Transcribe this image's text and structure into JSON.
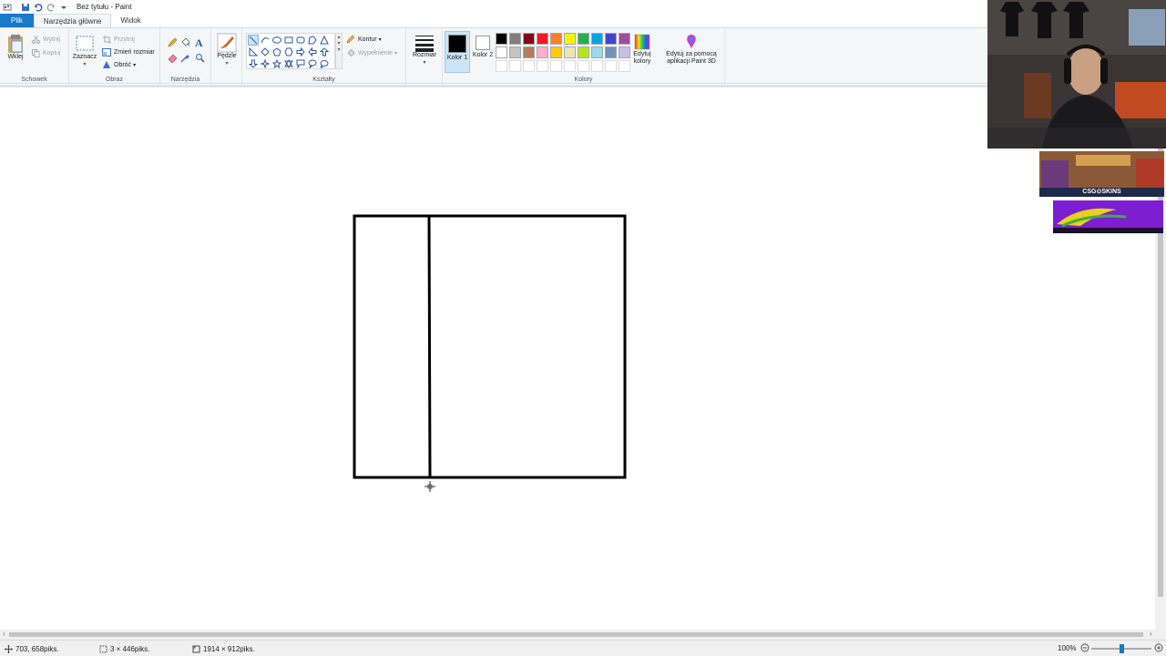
{
  "window": {
    "title": "Bez tytułu - Paint"
  },
  "tabs": [
    {
      "label": "Plik"
    },
    {
      "label": "Narzędzia główne"
    },
    {
      "label": "Widok"
    }
  ],
  "ribbon": {
    "clipboard": {
      "paste_label": "Wklej",
      "cut_label": "Wytnij",
      "copy_label": "Kopiuj",
      "group_label": "Schowek"
    },
    "image": {
      "select_label": "Zaznacz",
      "crop_label": "Przytnij",
      "resize_label": "Zmień rozmiar",
      "rotate_label": "Obróć",
      "group_label": "Obraz"
    },
    "tools": {
      "group_label": "Narzędzia"
    },
    "brushes": {
      "label": "Pędzle"
    },
    "shapes": {
      "outline_label": "Kontur",
      "fill_label": "Wypełnienie",
      "group_label": "Kształty"
    },
    "size": {
      "label": "Rozmiar"
    },
    "colors": {
      "color1_label": "Kolor 1",
      "color2_label": "Kolor 2",
      "edit_colors_label": "Edytuj kolory",
      "paint3d_label": "Edytuj za pomocą aplikacji Paint 3D",
      "group_label": "Kolory",
      "color1": "#000000",
      "color2": "#ffffff",
      "palette_row1": [
        "#000000",
        "#7f7f7f",
        "#880015",
        "#ed1c24",
        "#ff7f27",
        "#fff200",
        "#22b14c",
        "#00a2e8",
        "#3f48cc",
        "#a349a4"
      ],
      "palette_row2": [
        "#ffffff",
        "#c3c3c3",
        "#b97a57",
        "#ffaec9",
        "#ffc90e",
        "#efe4b0",
        "#b5e61d",
        "#99d9ea",
        "#7092be",
        "#c8bfe7"
      ]
    }
  },
  "canvas": {
    "drawing": "black rectangle outline with a vertical dividing line"
  },
  "status": {
    "cursor_position": "703, 658piks.",
    "selection_size": "3 × 446piks.",
    "image_size": "1914 × 912piks.",
    "zoom": "100%"
  },
  "overlays": {
    "sponsor1_text": "CSG⊙SKINS"
  }
}
